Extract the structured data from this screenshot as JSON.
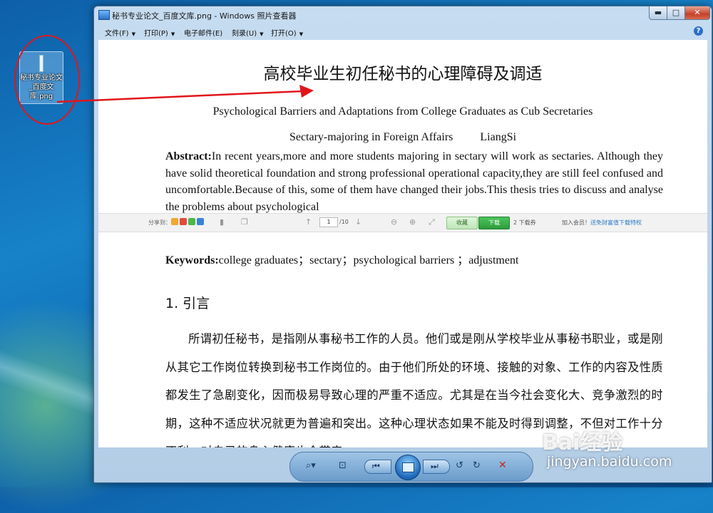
{
  "desktop": {
    "icon_label": "秘书专业论文_百度文库.png"
  },
  "window": {
    "title": "秘书专业论文_百度文库.png - Windows 照片查看器",
    "minimize": "▬",
    "maximize": "□",
    "close": "✕"
  },
  "menu": {
    "items": [
      "文件(F)",
      "打印(P)",
      "电子邮件(E)",
      "刻录(U)",
      "打开(O)"
    ],
    "help": "?"
  },
  "document": {
    "title_cn": "高校毕业生初任秘书的心理障碍及调适",
    "title_en": "Psychological Barriers and Adaptations from College Graduates as Cub Secretaries",
    "author_major": "Sectary-majoring in Foreign Affairs",
    "author_name": "LiangSi",
    "abstract_label": "Abstract:",
    "abstract_text": "In recent years,more and more students majoring in sectary will work as sectaries. Although they have solid theoretical foundation and strong professional operational capacity,they are still feel confused and uncomfortable.Because of this, some of them have changed their jobs.This thesis tries to discuss and analyse the problems about psychological",
    "keywords_label": "Keywords:",
    "keywords_text": "college graduates；sectary；psychological barriers ；adjustment",
    "section_title": "1.  引言",
    "body": "所谓初任秘书，是指刚从事秘书工作的人员。他们或是刚从学校毕业从事秘书职业，或是刚从其它工作岗位转换到秘书工作岗位的。由于他们所处的环境、接触的对象、工作的内容及性质都发生了急剧变化，因而极易导致心理的严重不适应。尤其是在当今社会变化大、竞争激烈的时期，这种不适应状况就更为普遍和突出。这种心理状态如果不能及时得到调整，不但对工作十分不利，对自己的身心健康也会带来"
  },
  "wenku_bar": {
    "share_label": "分享到：",
    "page_current": "1",
    "page_total": "/10",
    "favorite": "收藏",
    "download": "下载",
    "download_count": "2 下载券",
    "vip_prefix": "加入会员！",
    "vip_link": "送免财富值下载特权"
  },
  "watermark": {
    "brand": "Bai经验",
    "url": "jingyan.baidu.com"
  }
}
